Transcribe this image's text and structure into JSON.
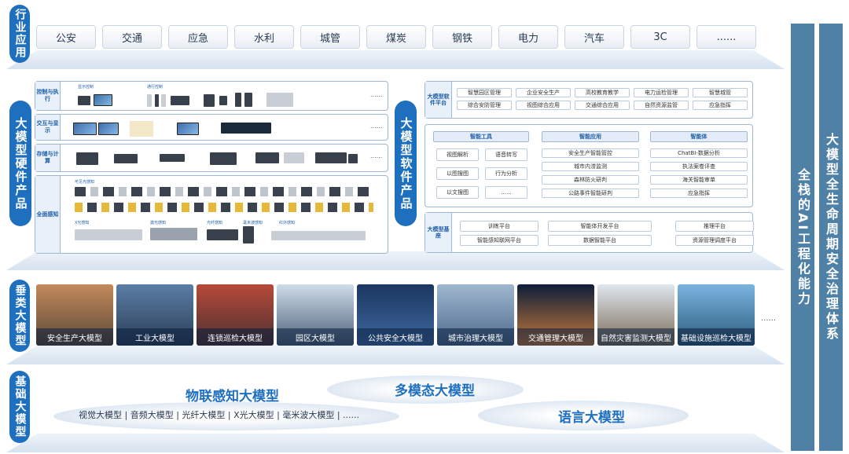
{
  "industry": {
    "label": "行业应用",
    "items": [
      "公安",
      "交通",
      "应急",
      "水利",
      "城管",
      "煤炭",
      "钢铁",
      "电力",
      "汽车",
      "3C",
      "......"
    ]
  },
  "hardware": {
    "label": "大模型硬件产品",
    "rows": [
      {
        "label": "控制与执行",
        "subs": [
          "显示控制",
          "通行控制"
        ]
      },
      {
        "label": "交互与显示",
        "subs": [
          "可交互显示"
        ]
      },
      {
        "label": "存储与计算",
        "subs": []
      },
      {
        "label": "全面感知",
        "subs": [
          "可见光感知",
          "X光感知",
          "激光感知",
          "光纤感知",
          "毫米波感知",
          "红外感知"
        ]
      }
    ],
    "ellipsis": "......"
  },
  "software": {
    "label": "大模型软件产品",
    "platform_label": "大模型软件平台",
    "platform_items": [
      "智慧园区管理",
      "企业安全生产",
      "高校教育教学",
      "电力运检管理",
      "智慧城管",
      "综合安防管理",
      "视图综合应用",
      "交通综合应用",
      "自然资源监管",
      "应急指挥"
    ],
    "tools_head": "智能工具",
    "tools": [
      "视图解析",
      "语音转写",
      "以图搜图",
      "行为分析",
      "以文搜图",
      "......"
    ],
    "apps_head": "智能应用",
    "apps": [
      "安全生产智能管控",
      "城市内涝监测",
      "森林防火研判",
      "公路事件智能研判"
    ],
    "agents_head": "智能体",
    "agents": [
      "ChatBI-数据分析",
      "执法案卷评查",
      "海关智能审单",
      "应急指挥"
    ],
    "base_label": "大模型基座",
    "base_items": [
      "训练平台",
      "智能体开发平台",
      "推理平台",
      "智能感知联网平台",
      "数据智能平台",
      "资源管理调度平台"
    ]
  },
  "vertical": {
    "label": "垂类大模型",
    "tiles": [
      "安全生产大模型",
      "工业大模型",
      "连锁巡检大模型",
      "园区大模型",
      "公共安全大模型",
      "城市治理大模型",
      "交通管理大模型",
      "自然灾害监测大模型",
      "基础设施巡检大模型"
    ],
    "ellipsis": "......"
  },
  "base_models": {
    "label": "基础大模型",
    "iot": "物联感知大模型",
    "iot_sub": "视觉大模型 | 音频大模型 | 光纤大模型 | X光大模型 | 毫米波大模型 | ......",
    "multimodal": "多模态大模型",
    "language": "语言大模型"
  },
  "right_bars": {
    "bar1": "全栈的AI工程化能力",
    "bar2": "大模型全生命周期安全治理体系"
  },
  "colors": {
    "accent": "#1f6fbf",
    "bar": "#4f81a7",
    "platform": "#d6e2ef"
  }
}
